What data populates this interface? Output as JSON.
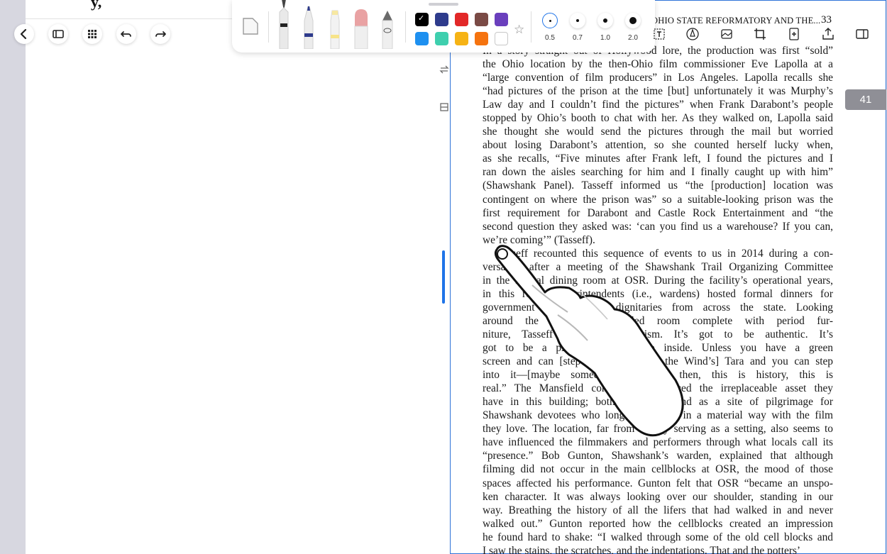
{
  "left_page": {
    "top_text": "y,",
    "icons": [
      "sidebar-icon",
      "grid-icon",
      "undo-icon",
      "redo-icon"
    ]
  },
  "toolbar": {
    "tools": [
      "page-tool",
      "fountain-pen",
      "ballpoint-pen",
      "highlighter",
      "eraser",
      "lasso"
    ],
    "colors": [
      "#000000",
      "#2e3b8c",
      "#e22828",
      "#7a4a45",
      "#6a3fbd",
      "#1e90f0",
      "#3ecfae",
      "#f6b315",
      "#f5730f",
      "#ffffff"
    ],
    "selected_color": "#000000",
    "stroke_sizes": [
      "0.5",
      "0.7",
      "1.0",
      "2.0"
    ],
    "selected_stroke": "0.5"
  },
  "right_tools": [
    "text-tool-icon",
    "pen-tool-icon",
    "image-icon",
    "crop-icon",
    "add-page-icon",
    "share-icon",
    "side-panel-icon"
  ],
  "page": {
    "running_head": "OHIO STATE REFORMATORY AND THE...",
    "page_number": "33",
    "badge": "41",
    "lines": [
      "In a story straight out of Hollywood lore, the production was first “sold”",
      "the Ohio location by the then-Ohio film commissioner Eve Lapolla at a",
      "“large convention of film producers” in Los Angeles. Lapolla recalls she",
      "“had pictures of the prison at the time [but] unfortunately it was Murphy’s",
      "Law day and I couldn’t find the pictures” when Frank Darabont’s people",
      "stopped by Ohio’s booth to chat with her. As they walked on, Lapolla said",
      "she thought she would send the pictures through the mail but worried",
      "about losing Darabont’s attention, so she counted herself lucky when,",
      "as she recalls, “Five minutes after Frank left, I found the pictures and I",
      "ran down the aisles searching for him and I finally caught up with him”",
      "(Shawshank Panel). Tasseff informed us “the [production] location was",
      "contingent on where the prison was” so a suitable-looking prison was the",
      "first requirement for Darabont and Castle Rock Entertainment and “the",
      "second question they asked was: ‘can you find us a warehouse? If you can,",
      "we’re coming’” (Tasseff).",
      "Tasseff recounted this sequence of events to us in 2014 during a con-",
      "versation after a meeting of the Shawshank Trail Organizing Committee",
      "in the formal dining room at OSR. During the facility’s operational years,",
      "in this room, superintendents (i.e., wardens) hosted formal dinners for",
      "government officials and dignitaries from across the state. Looking",
      "around the dark wood-paneled room complete with period fur-",
      "niture, Tasseff said, “For tourism. It’s got to be authentic. It’s",
      "got to be a place you can step inside. Unless you have a green",
      "screen and can [step into Gone with the Wind’s] Tara and you can step",
      "into it—[maybe someday] but until then, this is history, this is",
      "real.” The Mansfield community embraced the irreplaceable asset they",
      "have in this building; both as history and as a site of pilgrimage for",
      "Shawshank devotees who long to connect in a material way with the film",
      "they love. The location, far from simply serving as a setting, also seems to",
      "have influenced the filmmakers and performers through what locals call its",
      "“presence.” Bob Gunton, Shawshank’s warden, explained that although",
      "filming did not occur in the main cellblocks at OSR, the mood of those",
      "spaces affected his performance. Gunton felt that OSR “became an unspo-",
      "ken character. It was always looking over our shoulder, standing in our",
      "way. Breathing the history of all the lifers that had walked in and never",
      "walked out.” Gunton reported how the cellblocks created an impression",
      "he found hard to shake: “I walked through some of the old cell blocks and",
      "I saw the stains, the scratches, and the indentations. That and the potters’"
    ]
  }
}
